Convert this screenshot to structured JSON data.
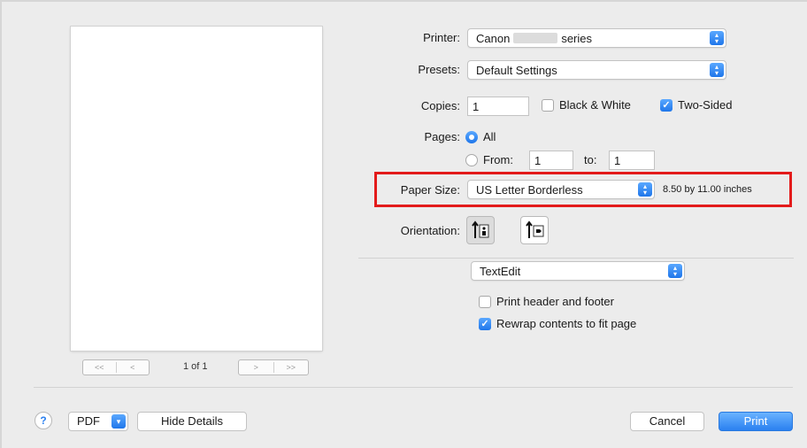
{
  "printer": {
    "label": "Printer:",
    "value_prefix": "Canon",
    "value_suffix": "series"
  },
  "presets": {
    "label": "Presets:",
    "value": "Default Settings"
  },
  "copies": {
    "label": "Copies:",
    "value": "1",
    "black_white_label": "Black & White",
    "black_white_checked": false,
    "two_sided_label": "Two-Sided",
    "two_sided_checked": true
  },
  "pages": {
    "label": "Pages:",
    "all_label": "All",
    "from_label": "From:",
    "from_value": "1",
    "to_label": "to:",
    "to_value": "1",
    "selected": "all"
  },
  "paper_size": {
    "label": "Paper Size:",
    "value": "US Letter Borderless",
    "dimensions": "8.50 by 11.00 inches"
  },
  "orientation": {
    "label": "Orientation:",
    "options": [
      "portrait",
      "landscape"
    ],
    "selected": "portrait"
  },
  "section_popup": {
    "value": "TextEdit"
  },
  "textedit_options": {
    "header_footer_label": "Print header and footer",
    "header_footer_checked": false,
    "rewrap_label": "Rewrap contents to fit page",
    "rewrap_checked": true
  },
  "preview": {
    "page_indicator": "1 of 1",
    "first_icon": "double-left-chevron",
    "prev_icon": "left-chevron",
    "next_icon": "right-chevron",
    "last_icon": "double-right-chevron"
  },
  "footer": {
    "help_label": "?",
    "pdf_label": "PDF",
    "hide_details_label": "Hide Details",
    "cancel_label": "Cancel",
    "print_label": "Print"
  },
  "colors": {
    "accent": "#2a80f0",
    "highlight": "#e31b1b",
    "background": "#ececec"
  }
}
